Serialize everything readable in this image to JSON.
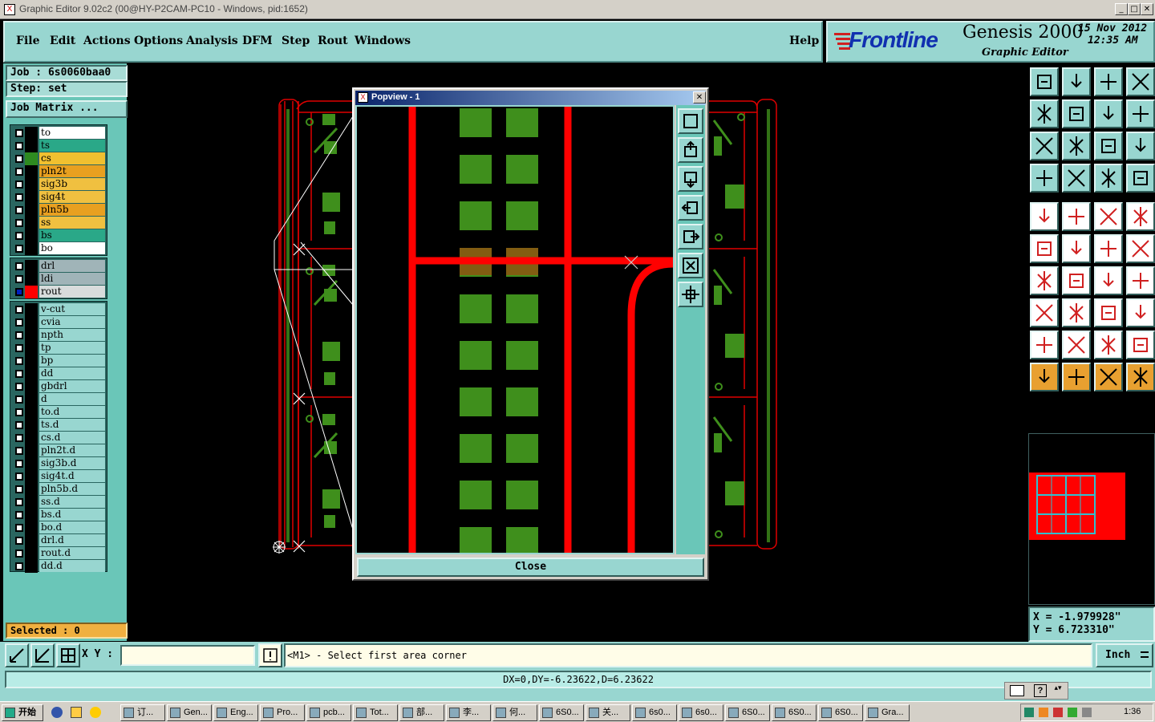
{
  "window": {
    "title": "Graphic Editor 9.02c2 (00@HY-P2CAM-PC10 - Windows, pid:1652)",
    "buttons": [
      "_",
      "□",
      "✕"
    ]
  },
  "menu": {
    "items": [
      "File",
      "Edit",
      "Actions",
      "Options",
      "Analysis",
      "DFM",
      "Step",
      "Rout",
      "Windows"
    ],
    "help": "Help"
  },
  "brand": {
    "logo": "Frontline",
    "product": "Genesis 2000",
    "subtitle": "Graphic Editor",
    "date": "15 Nov 2012",
    "time": "12:35 AM"
  },
  "job": {
    "job_label": "Job : 6s0060baa0",
    "step_label": "Step: set",
    "matrix_button": "Job Matrix ..."
  },
  "layers_board": [
    {
      "name": "to",
      "color": "#ffffff",
      "aff": "#000000"
    },
    {
      "name": "ts",
      "color": "#2aa888",
      "aff": "#000000"
    },
    {
      "name": "cs",
      "color": "#f0c030",
      "aff": "#2e8b20"
    },
    {
      "name": "pln2t",
      "color": "#e8a020",
      "aff": "#000000"
    },
    {
      "name": "sig3b",
      "color": "#f0c040",
      "aff": "#000000"
    },
    {
      "name": "sig4t",
      "color": "#f0c040",
      "aff": "#000000"
    },
    {
      "name": "pln5b",
      "color": "#e8a020",
      "aff": "#000000"
    },
    {
      "name": "ss",
      "color": "#f0c040",
      "aff": "#000000"
    },
    {
      "name": "bs",
      "color": "#2aa888",
      "aff": "#000000"
    },
    {
      "name": "bo",
      "color": "#ffffff",
      "aff": "#000000"
    }
  ],
  "layers_drill": [
    {
      "name": "drl",
      "color": "#a0b4b8",
      "aff": "#000000"
    },
    {
      "name": "ldi",
      "color": "#a0b4b8",
      "aff": "#000000"
    },
    {
      "name": "rout",
      "color": "#d8dcdc",
      "aff": "#ff0000",
      "checked_blue": true
    }
  ],
  "layers_misc": [
    {
      "name": "v-cut"
    },
    {
      "name": "cvia"
    },
    {
      "name": "npth"
    },
    {
      "name": "tp"
    },
    {
      "name": "bp"
    },
    {
      "name": "dd"
    },
    {
      "name": "gbdrl"
    },
    {
      "name": "d"
    },
    {
      "name": "to.d"
    },
    {
      "name": "ts.d"
    },
    {
      "name": "cs.d"
    },
    {
      "name": "pln2t.d"
    },
    {
      "name": "sig3b.d"
    },
    {
      "name": "sig4t.d"
    },
    {
      "name": "pln5b.d"
    },
    {
      "name": "ss.d"
    },
    {
      "name": "bs.d"
    },
    {
      "name": "bo.d"
    },
    {
      "name": "drl.d"
    },
    {
      "name": "rout.d"
    },
    {
      "name": "dd.d"
    }
  ],
  "selected_label": "Selected : 0",
  "popview": {
    "title": "Popview - 1",
    "close_label": "Close"
  },
  "coords": {
    "x": "X = -1.979928\"",
    "y": "Y = 6.723310\""
  },
  "command": {
    "xy_label": "X Y :",
    "xy_value": "",
    "prompt": "<M1> - Select first area corner",
    "units": "Inch"
  },
  "status": {
    "readout": "DX=0,DY=-6.23622,D=6.23622"
  },
  "taskbar": {
    "start": "开始",
    "tasks": [
      "订...",
      "Gen...",
      "Eng...",
      "Pro...",
      "pcb...",
      "Tot...",
      "部...",
      "李...",
      "何...",
      "6S0...",
      "关...",
      "6s0...",
      "6s0...",
      "6S0...",
      "6S0...",
      "6S0...",
      "Gra..."
    ],
    "clock": "1:36"
  },
  "colors": {
    "panel": "#98d6d0",
    "rout": "#ff0000",
    "copper": "#3f8f1c",
    "accent": "#e8a030"
  }
}
